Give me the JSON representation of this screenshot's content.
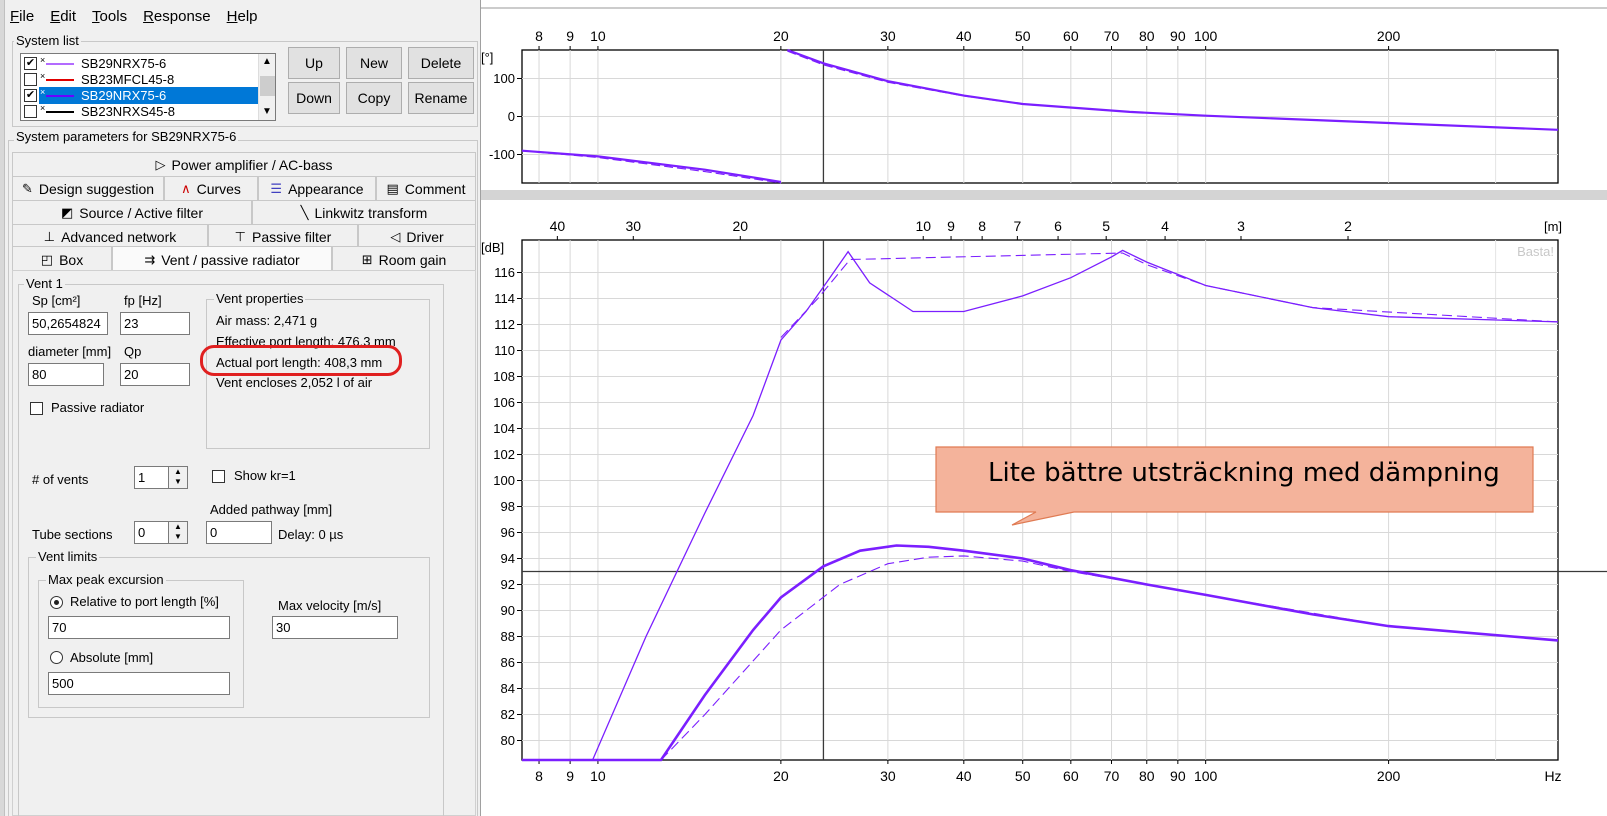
{
  "menu": [
    "File",
    "Edit",
    "Tools",
    "Response",
    "Help"
  ],
  "system_list": {
    "label": "System list",
    "items": [
      {
        "name": "SB29NRX75-6",
        "checked": true,
        "color": "#b36bff",
        "selected": false
      },
      {
        "name": "SB23MFCL45-8",
        "checked": false,
        "color": "#e00000",
        "selected": false
      },
      {
        "name": "SB29NRX75-6",
        "checked": true,
        "color": "#6a00ff",
        "selected": true
      },
      {
        "name": "SB23NRXS45-8",
        "checked": false,
        "color": "#000000",
        "selected": false
      }
    ]
  },
  "buttons": {
    "up": "Up",
    "new": "New",
    "delete": "Delete",
    "down": "Down",
    "copy": "Copy",
    "rename": "Rename"
  },
  "params_label": "System parameters for SB29NRX75-6",
  "tabs": {
    "power": "Power amplifier / AC-bass",
    "design": "Design suggestion",
    "curves": "Curves",
    "appearance": "Appearance",
    "comment": "Comment",
    "source": "Source / Active filter",
    "linkwitz": "Linkwitz transform",
    "advanced": "Advanced network",
    "passive": "Passive filter",
    "driver": "Driver",
    "box": "Box",
    "vent": "Vent / passive radiator",
    "room": "Room gain"
  },
  "vent": {
    "group": "Vent 1",
    "sp_label": "Sp [cm²]",
    "sp_value": "50,2654824",
    "fp_label": "fp [Hz]",
    "fp_value": "23",
    "diameter_label": "diameter [mm]",
    "diameter_value": "80",
    "qp_label": "Qp",
    "qp_value": "20",
    "passive_radiator": "Passive radiator",
    "props_label": "Vent properties",
    "air_mass": "Air mass: 2,471 g",
    "effective_length": "Effective port length: 476,3 mm",
    "actual_length": "Actual port length: 408,3 mm",
    "encloses": "Vent encloses 2,052 l of air",
    "num_vents_label": "# of vents",
    "num_vents_value": "1",
    "show_kr": "Show kr=1",
    "added_pathway_label": "Added pathway [mm]",
    "tube_sections_label": "Tube sections",
    "tube_sections_value": "0",
    "added_pathway_value": "0",
    "delay": "Delay: 0 µs",
    "limits_label": "Vent limits",
    "max_peak_label": "Max peak excursion",
    "relative_label": "Relative to port length [%]",
    "relative_value": "70",
    "absolute_label": "Absolute [mm]",
    "absolute_value": "500",
    "max_velocity_label": "Max velocity [m/s]",
    "max_velocity_value": "30"
  },
  "chart_data": [
    {
      "type": "line",
      "ylabel": "[°]",
      "x_scale": "log",
      "xlim": [
        7.5,
        380
      ],
      "ylim": [
        -175,
        175
      ],
      "yticks": [
        100,
        0,
        -100
      ],
      "xticks": [
        8,
        9,
        10,
        20,
        30,
        40,
        50,
        60,
        70,
        80,
        90,
        100,
        200
      ],
      "cursor_x": 23.5,
      "series": [
        {
          "style": "solid",
          "segments": [
            [
              [
                20.5,
                175
              ],
              [
                23.5,
                140
              ],
              [
                30,
                93
              ],
              [
                40,
                55
              ],
              [
                50,
                33
              ],
              [
                75,
                12
              ],
              [
                100,
                2
              ],
              [
                200,
                -17
              ],
              [
                380,
                -35
              ]
            ],
            [
              [
                7.5,
                -90
              ],
              [
                10,
                -105
              ],
              [
                15,
                -140
              ],
              [
                20,
                -172
              ]
            ]
          ]
        },
        {
          "style": "dashed",
          "segments": [
            [
              [
                20.5,
                172
              ],
              [
                23.5,
                136
              ],
              [
                30,
                90
              ],
              [
                40,
                54
              ],
              [
                50,
                32
              ],
              [
                75,
                12
              ],
              [
                100,
                2
              ],
              [
                200,
                -17
              ],
              [
                380,
                -35
              ]
            ],
            [
              [
                7.5,
                -90
              ],
              [
                10,
                -108
              ],
              [
                15,
                -145
              ],
              [
                20,
                -175
              ]
            ]
          ]
        }
      ]
    },
    {
      "type": "line",
      "ylabel": "[dB]",
      "x_scale": "log",
      "xlim": [
        7.5,
        380
      ],
      "ylim": [
        78.5,
        118.5
      ],
      "yticks": [
        80,
        82,
        84,
        86,
        88,
        90,
        92,
        94,
        96,
        98,
        100,
        102,
        104,
        106,
        108,
        110,
        112,
        114,
        116
      ],
      "xticks": [
        8,
        9,
        10,
        20,
        30,
        40,
        50,
        60,
        70,
        80,
        90,
        100,
        200
      ],
      "x_unit": "Hz",
      "top_axis_unit": "[m]",
      "top_ticks": [
        40,
        30,
        20,
        10,
        9,
        8,
        7,
        6,
        5,
        4,
        3,
        2
      ],
      "cursor_x": 23.5,
      "cursor_y": 93,
      "watermark": "Basta!",
      "series": [
        {
          "name": "",
          "style": "thin",
          "points": [
            [
              7.5,
              78.5
            ],
            [
              9.8,
              78.5
            ],
            [
              12,
              88
            ],
            [
              15,
              97.5
            ],
            [
              18,
              105
            ],
            [
              20,
              110.8
            ],
            [
              22,
              113
            ],
            [
              24,
              115.5
            ],
            [
              25.8,
              117.6
            ],
            [
              28,
              115.2
            ],
            [
              33,
              113
            ],
            [
              40,
              113
            ],
            [
              50,
              114.2
            ],
            [
              60,
              115.6
            ],
            [
              70,
              117.2
            ],
            [
              73,
              117.7
            ],
            [
              80,
              116.8
            ],
            [
              100,
              115
            ],
            [
              150,
              113.3
            ],
            [
              200,
              112.6
            ],
            [
              380,
              112.2
            ]
          ]
        },
        {
          "name": "",
          "style": "dashed",
          "points": [
            [
              20,
              111
            ],
            [
              23,
              114
            ],
            [
              26,
              117
            ],
            [
              73,
              117.5
            ],
            [
              80,
              116.6
            ],
            [
              100,
              115
            ],
            [
              150,
              113.3
            ],
            [
              380,
              112.2
            ]
          ]
        },
        {
          "name": "",
          "style": "thick",
          "points": [
            [
              7.5,
              78.5
            ],
            [
              12.7,
              78.5
            ],
            [
              15,
              83.5
            ],
            [
              18,
              88.5
            ],
            [
              20,
              91
            ],
            [
              23.5,
              93.4
            ],
            [
              27,
              94.6
            ],
            [
              31,
              95
            ],
            [
              35,
              94.9
            ],
            [
              40,
              94.6
            ],
            [
              50,
              94
            ],
            [
              60,
              93.1
            ],
            [
              80,
              92
            ],
            [
              100,
              91.2
            ],
            [
              150,
              89.7
            ],
            [
              200,
              88.8
            ],
            [
              380,
              87.7
            ]
          ]
        },
        {
          "name": "",
          "style": "dashed",
          "points": [
            [
              12.7,
              78.5
            ],
            [
              15,
              82
            ],
            [
              20,
              88.5
            ],
            [
              25,
              92
            ],
            [
              30,
              93.6
            ],
            [
              35,
              94.1
            ],
            [
              40,
              94.2
            ],
            [
              50,
              93.8
            ],
            [
              60,
              93
            ],
            [
              80,
              92
            ],
            [
              100,
              91.2
            ],
            [
              200,
              88.8
            ],
            [
              380,
              87.7
            ]
          ]
        }
      ]
    }
  ],
  "callout": {
    "text": "Lite bättre utsträckning med dämpning",
    "fill": "#f4b39b",
    "border": "#e07b53"
  },
  "colors": {
    "curve": "#7b1fff",
    "accent": "#0078d7"
  }
}
